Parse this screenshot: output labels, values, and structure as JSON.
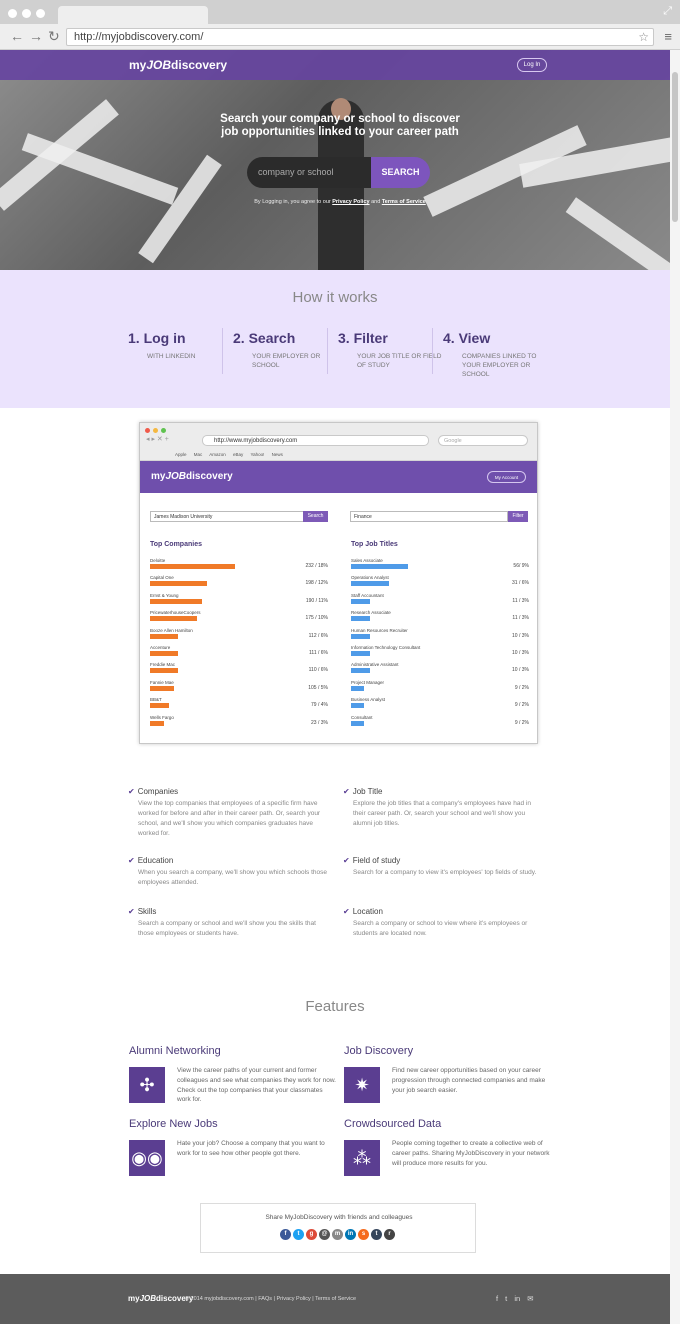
{
  "browser": {
    "url": "http://myjobdiscovery.com/"
  },
  "header": {
    "logo_pre": "my",
    "logo_job": "JOB",
    "logo_post": "discovery",
    "login_label": "Log In"
  },
  "hero": {
    "headline_1": "Search your company or school to discover",
    "headline_2": "job opportunities linked to your career path",
    "search_placeholder": "company or school",
    "search_button": "SEARCH",
    "policy_pre": "By Logging in, you agree to our",
    "policy_link": "Privacy Policy",
    "policy_mid": "and",
    "terms_link": "Terms of Service"
  },
  "how": {
    "title": "How it works",
    "steps": [
      {
        "title": "1.  Log in",
        "desc": "WITH LINKEDIN"
      },
      {
        "title": "2.  Search",
        "desc": "YOUR EMPLOYER OR SCHOOL"
      },
      {
        "title": "3.  Filter",
        "desc": "YOUR JOB TITLE OR FIELD OF STUDY"
      },
      {
        "title": "4.  View",
        "desc": "COMPANIES LINKED TO YOUR EMPLOYER OR SCHOOL"
      }
    ]
  },
  "demo": {
    "url": "http://www.myjobdiscovery.com",
    "google": "Google",
    "bookmarks": "Apple  Mac  Amazon  eBay  Yahoo!  News",
    "account": "My Account",
    "left_input": "James Madison University",
    "left_button": "Search",
    "right_input": "Finance",
    "right_button": "Filter",
    "left_title": "Top Companies",
    "right_title": "Top Job Titles",
    "companies": [
      {
        "name": "Deloitte",
        "value": "232 / 18%",
        "share": 0.18
      },
      {
        "name": "Capital One",
        "value": "198 / 12%",
        "share": 0.12
      },
      {
        "name": "Ernst & Young",
        "value": "190 / 11%",
        "share": 0.11
      },
      {
        "name": "PricewaterhouseCoopers",
        "value": "175 / 10%",
        "share": 0.1
      },
      {
        "name": "Booze Allen Hamilton",
        "value": "112 / 6%",
        "share": 0.06
      },
      {
        "name": "Accenture",
        "value": "111 / 6%",
        "share": 0.06
      },
      {
        "name": "Freddie Mac",
        "value": "110 / 6%",
        "share": 0.06
      },
      {
        "name": "Fannie Mae",
        "value": "105 / 5%",
        "share": 0.05
      },
      {
        "name": "BB&T",
        "value": "79 / 4%",
        "share": 0.04
      },
      {
        "name": "Wells Fargo",
        "value": "23 / 3%",
        "share": 0.03
      }
    ],
    "titles": [
      {
        "name": "Sales Associate",
        "value": "56/ 9%",
        "share": 0.09
      },
      {
        "name": "Operations Analyst",
        "value": "31 / 6%",
        "share": 0.06
      },
      {
        "name": "Staff Accountant",
        "value": "11 / 3%",
        "share": 0.03
      },
      {
        "name": "Research Associate",
        "value": "11 / 3%",
        "share": 0.03
      },
      {
        "name": "Human Resources Recruiter",
        "value": "10 / 3%",
        "share": 0.03
      },
      {
        "name": "Information Technology Consultant",
        "value": "10 / 3%",
        "share": 0.03
      },
      {
        "name": "Administrative Assistant",
        "value": "10 / 3%",
        "share": 0.03
      },
      {
        "name": "Project Manager",
        "value": "9 / 2%",
        "share": 0.02
      },
      {
        "name": "Business Analyst",
        "value": "9 / 2%",
        "share": 0.02
      },
      {
        "name": "Consultant",
        "value": "9 / 2%",
        "share": 0.02
      }
    ]
  },
  "details": [
    {
      "title": "Companies",
      "desc": "View the top companies that employees of a specific firm have worked for before and after in their career path. Or, search your school, and we'll show you which companies graduates have worked for."
    },
    {
      "title": "Job Title",
      "desc": "Explore the job titles that a company's employees have had in their career path. Or, search your school and we'll show you alumni job titles."
    },
    {
      "title": "Education",
      "desc": "When you search a company, we'll show you which schools those employees attended."
    },
    {
      "title": "Field of study",
      "desc": "Search for a company to view it's employees' top fields of study."
    },
    {
      "title": "Skills",
      "desc": "Search a company or school and we'll show you the skills that those employees or students have."
    },
    {
      "title": "Location",
      "desc": "Search a company or school to view where it's employees or students are located now."
    }
  ],
  "features": {
    "title": "Features",
    "items": [
      {
        "title": "Alumni Networking",
        "icon": "network-icon",
        "desc": "View the career paths of your current and former colleagues and see what companies they work for now. Check out the top companies that your classmates work for."
      },
      {
        "title": "Job Discovery",
        "icon": "compass-icon",
        "desc": "Find new career opportunities based on your career progression through connected companies and make your job search easier."
      },
      {
        "title": "Explore New Jobs",
        "icon": "binoculars-icon",
        "desc": "Hate your job? Choose a company that you want to work for to see how other people got there."
      },
      {
        "title": "Crowdsourced Data",
        "icon": "crowd-icon",
        "desc": "People coming together to create a collective web of career paths. Sharing MyJobDiscovery in your network will produce more results for you."
      }
    ]
  },
  "share": {
    "text": "Share MyJobDiscovery with friends and colleagues"
  },
  "footer": {
    "copyright": "© 2014 myjobdiscovery.com | FAQs | Privacy Policy | Terms of Service",
    "social": "f  t  in  ✉"
  },
  "colors": {
    "brand": "#6644a0",
    "accent": "#7d55bd",
    "bar_orange": "#f07a28",
    "bar_blue": "#4f9be8"
  }
}
